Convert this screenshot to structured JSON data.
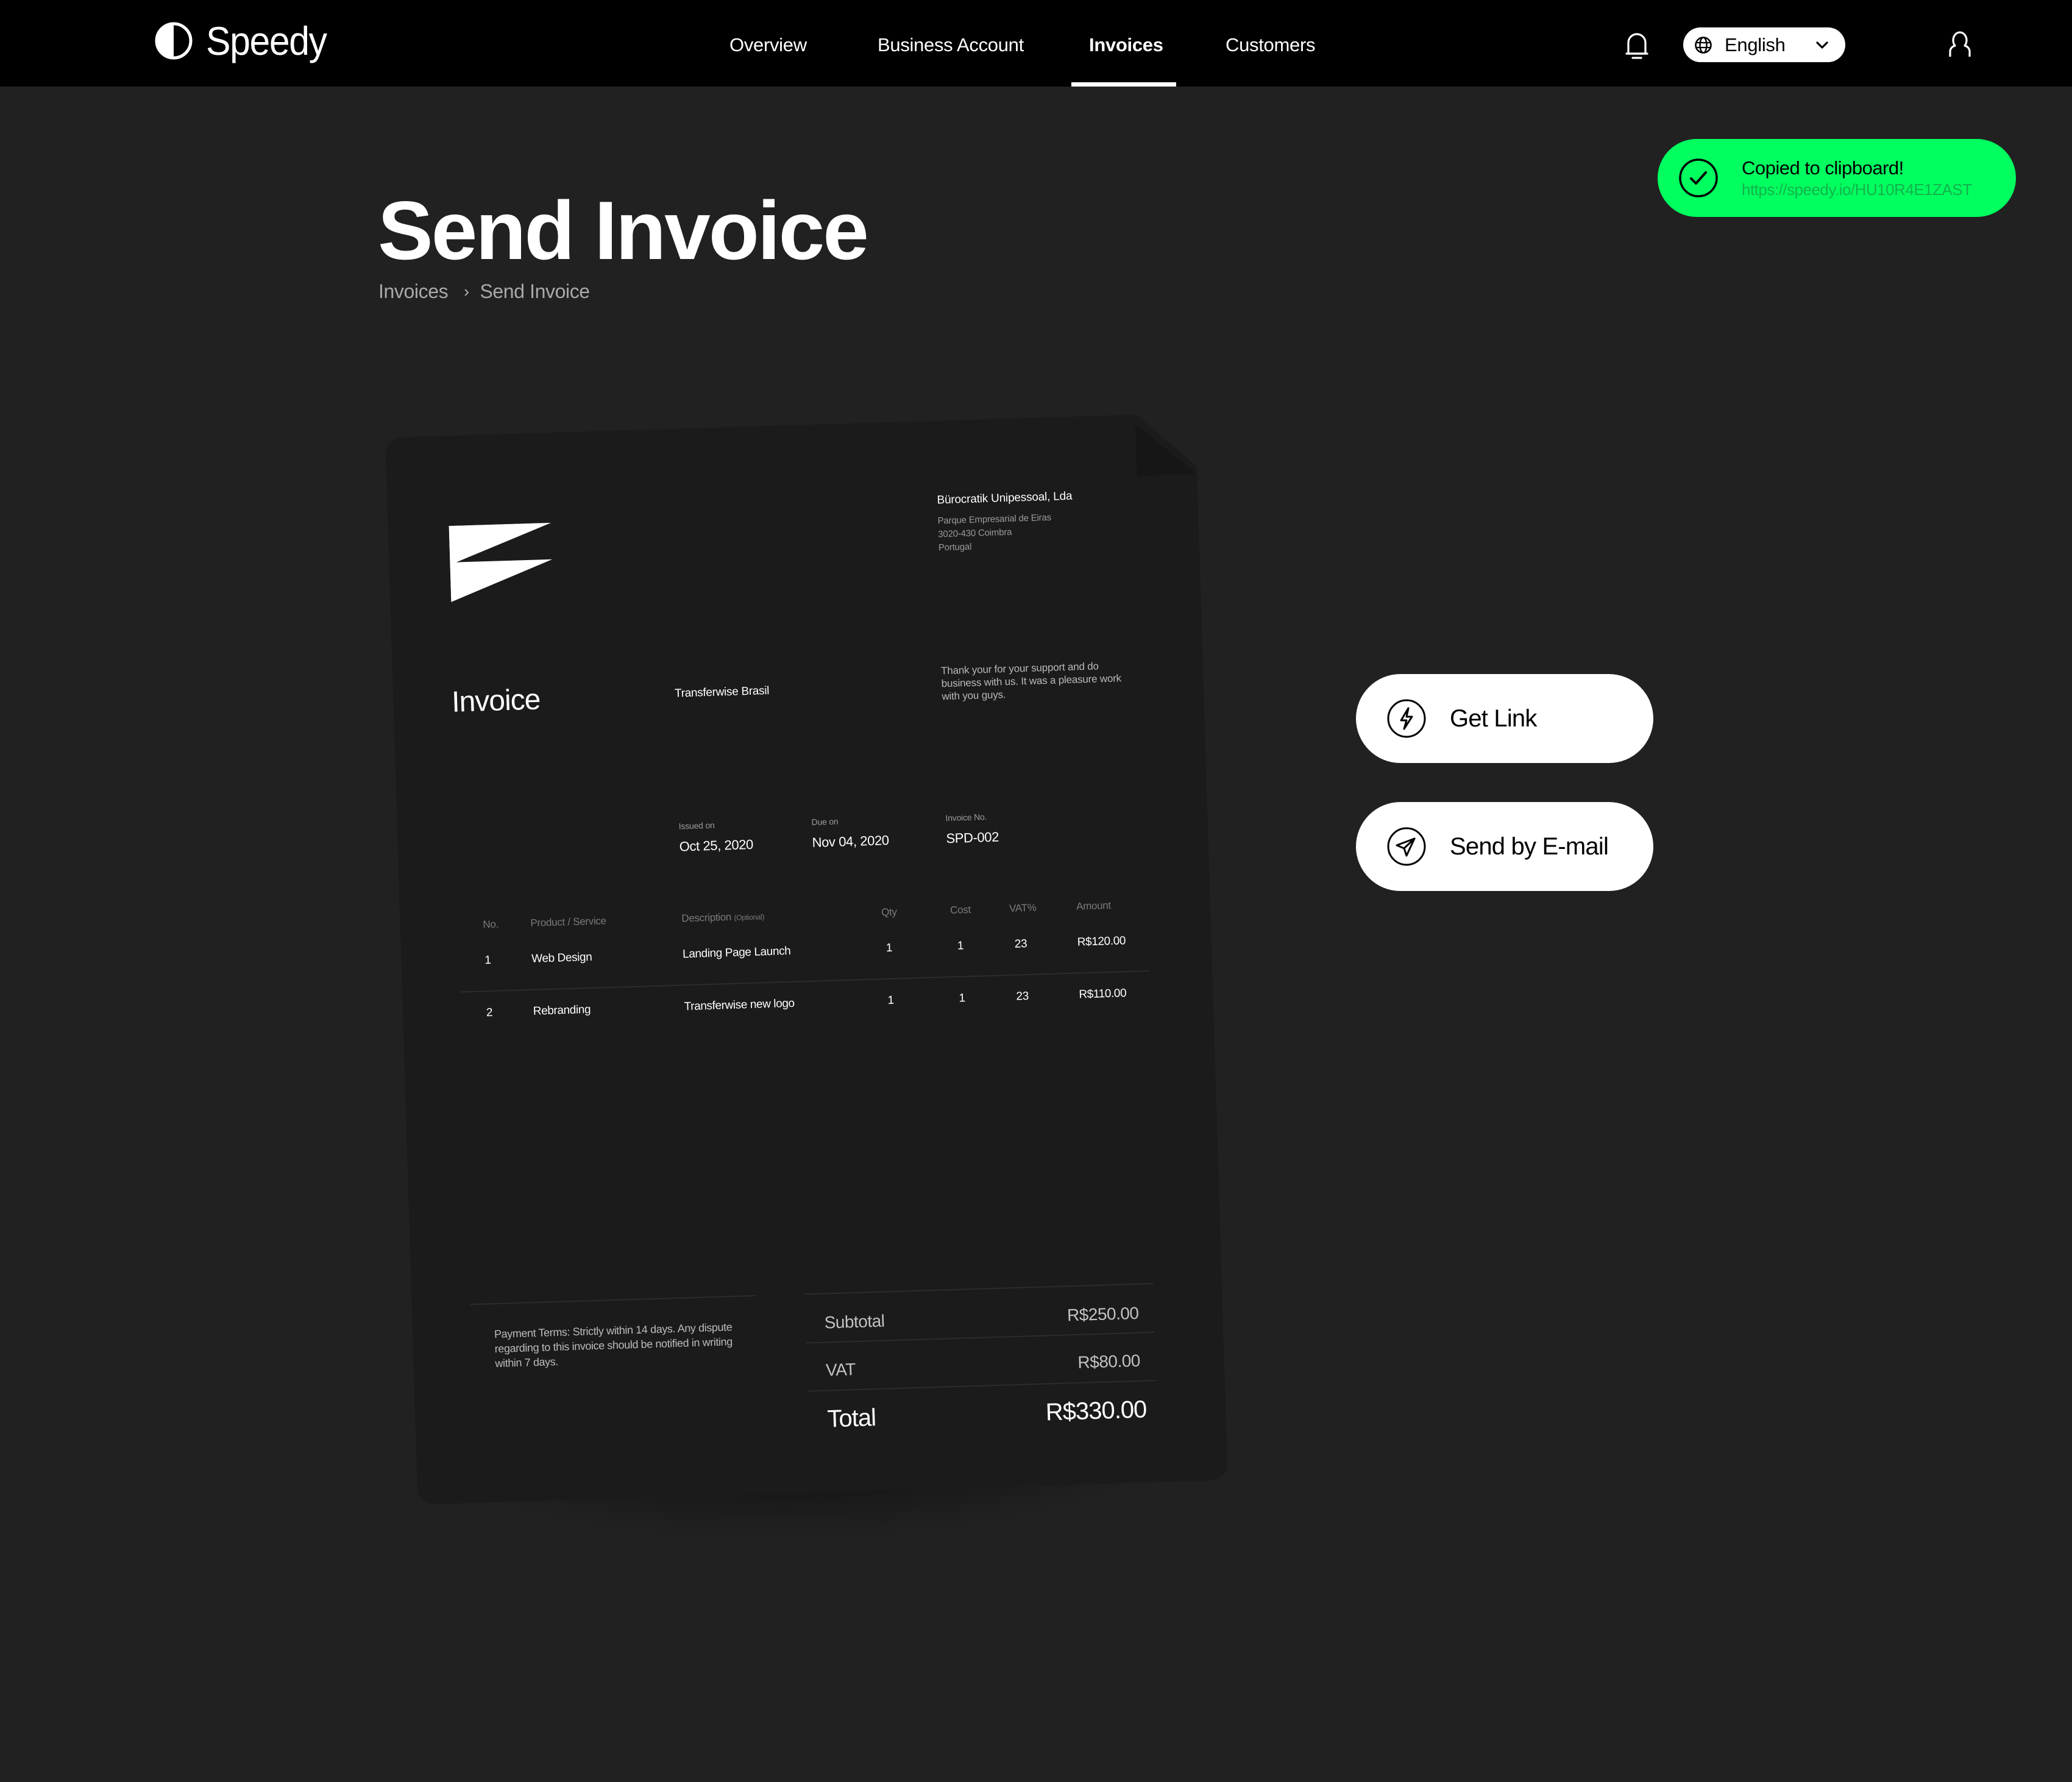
{
  "app": {
    "name": "Speedy"
  },
  "nav": {
    "items": [
      {
        "label": "Overview",
        "active": false
      },
      {
        "label": "Business Account",
        "active": false
      },
      {
        "label": "Invoices",
        "active": true
      },
      {
        "label": "Customers",
        "active": false
      }
    ],
    "language": {
      "selected": "English",
      "icon": "globe-icon"
    },
    "notifications_icon": "bell-icon",
    "account_icon": "user-icon"
  },
  "toast": {
    "title": "Copied to clipboard!",
    "link": "https://speedy.io/HU10R4E1ZAST",
    "icon": "check-circle-icon",
    "color": "#00ff5f"
  },
  "page": {
    "title": "Send Invoice",
    "breadcrumb": [
      {
        "label": "Invoices"
      },
      {
        "label": "Send Invoice"
      }
    ],
    "breadcrumb_separator": "›"
  },
  "invoice": {
    "issuer": {
      "name": "Bürocratik Unipessoal, Lda",
      "address": [
        "Parque Empresarial de Eiras",
        "3020-430 Coimbra",
        "Portugal"
      ]
    },
    "heading": "Invoice",
    "client": "Transferwise Brasil",
    "note": "Thank your for your support and do business with us. It was a pleasure work with you guys.",
    "meta": {
      "issued_label": "Issued on",
      "issued_value": "Oct 25, 2020",
      "due_label": "Due on",
      "due_value": "Nov 04, 2020",
      "number_label": "Invoice No.",
      "number_value": "SPD-002"
    },
    "table": {
      "headers": {
        "no": "No.",
        "product": "Product / Service",
        "description": "Description",
        "description_hint": "(Optional)",
        "qty": "Qty",
        "cost": "Cost",
        "vat": "VAT%",
        "amount": "Amount"
      },
      "rows": [
        {
          "no": "1",
          "product": "Web Design",
          "description": "Landing Page Launch",
          "qty": "1",
          "cost": "1",
          "vat": "23",
          "amount": "R$120.00"
        },
        {
          "no": "2",
          "product": "Rebranding",
          "description": "Transferwise new logo",
          "qty": "1",
          "cost": "1",
          "vat": "23",
          "amount": "R$110.00"
        }
      ]
    },
    "terms": "Payment Terms: Strictly within 14 days. Any dispute regarding to this invoice should be notified in writing within 7 days.",
    "summary": {
      "subtotal_label": "Subtotal",
      "subtotal_value": "R$250.00",
      "vat_label": "VAT",
      "vat_value": "R$80.00",
      "total_label": "Total",
      "total_value": "R$330.00"
    }
  },
  "actions": [
    {
      "label": "Get Link",
      "icon": "lightning-icon"
    },
    {
      "label": "Send by E-mail",
      "icon": "send-icon"
    }
  ]
}
